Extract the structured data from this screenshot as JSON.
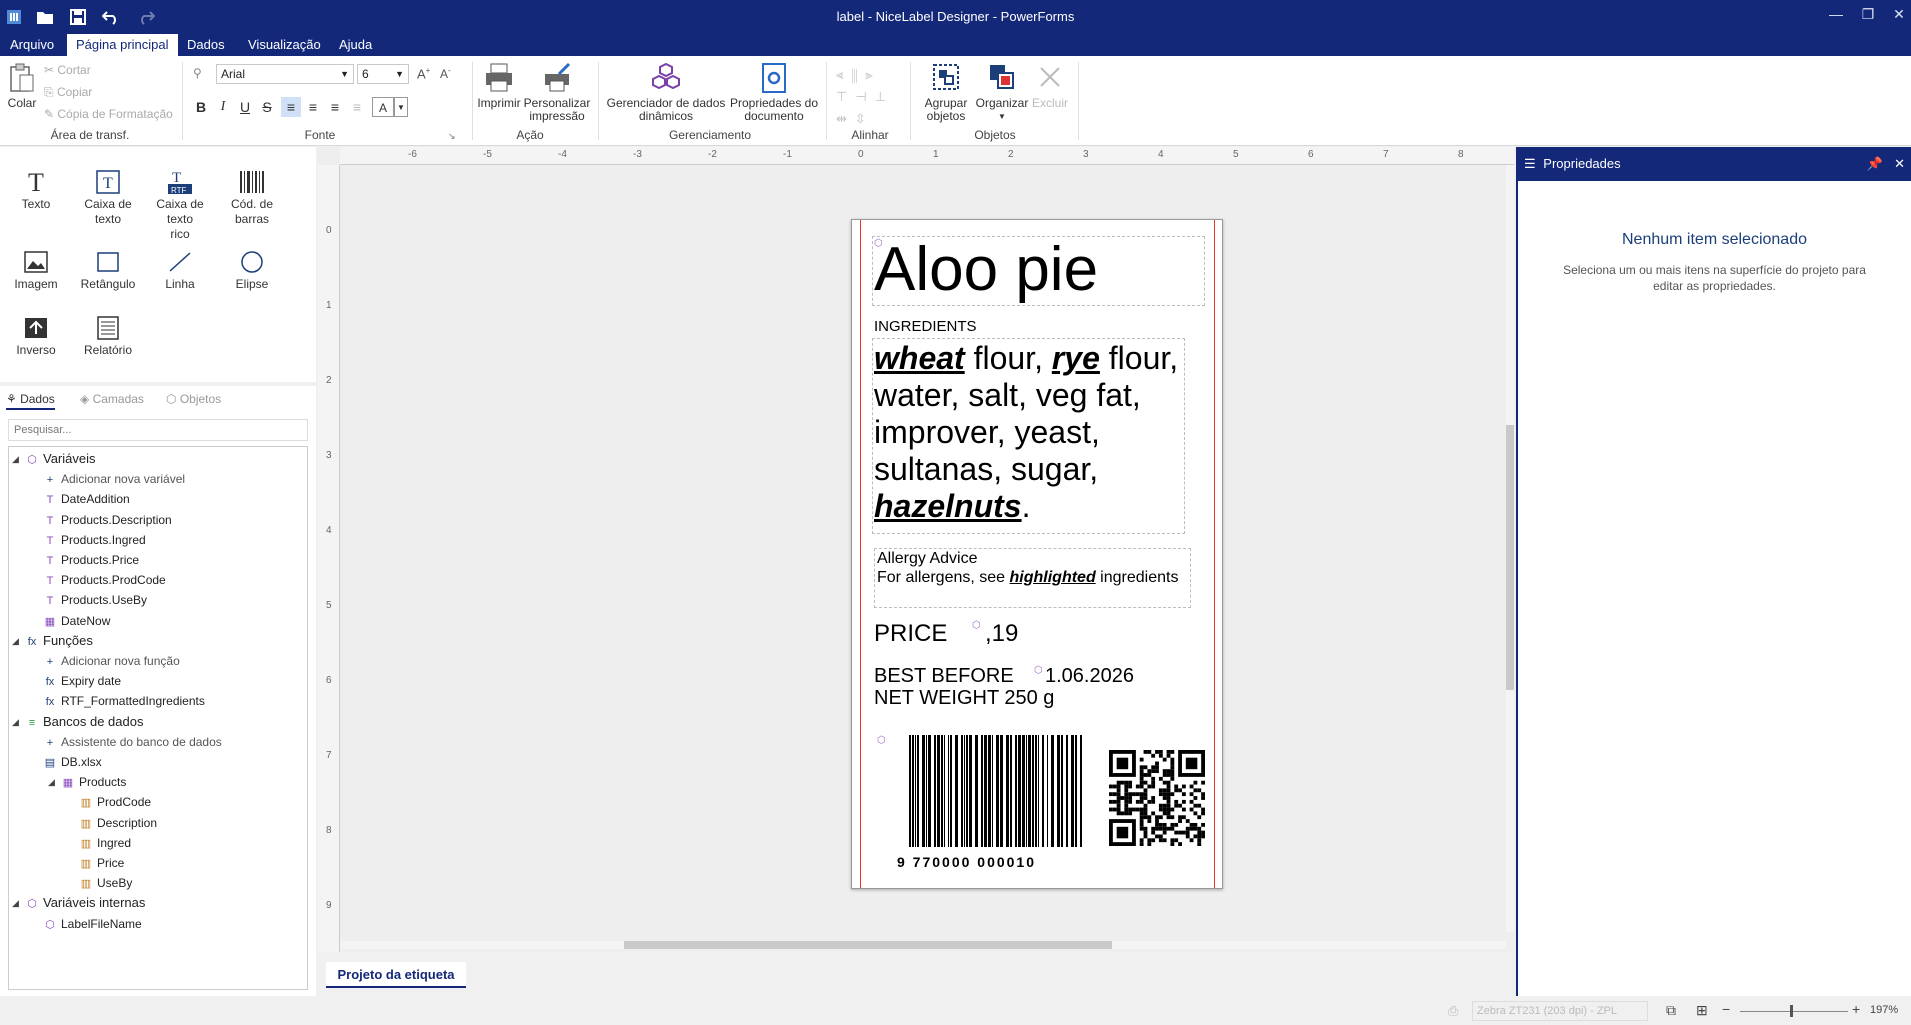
{
  "window": {
    "title": "label - NiceLabel Designer - PowerForms"
  },
  "menu": {
    "items": [
      "Arquivo",
      "Página principal",
      "Dados",
      "Visualização",
      "Ajuda"
    ],
    "active": "Página principal"
  },
  "ribbon": {
    "clipboard": {
      "paste": "Colar",
      "cut": "Cortar",
      "copy": "Copiar",
      "format_copy": "Cópia de Formatação",
      "group": "Área de transf."
    },
    "font": {
      "name": "Arial",
      "size": "6",
      "color_btn": "A",
      "group": "Fonte"
    },
    "action": {
      "print": "Imprimir",
      "customize1": "Personalizar",
      "customize2": "impressão",
      "group": "Ação"
    },
    "manage": {
      "dyn1": "Gerenciador de dados",
      "dyn2": "dinâmicos",
      "props1": "Propriedades do",
      "props2": "documento",
      "group": "Gerenciamento"
    },
    "align": {
      "group": "Alinhar"
    },
    "objects": {
      "group1": "Agrupar",
      "group2": "objetos",
      "arrange": "Organizar",
      "delete": "Excluir",
      "group": "Objetos"
    }
  },
  "toolbox": {
    "text": "Texto",
    "textbox1": "Caixa de",
    "textbox2": "texto",
    "rich1": "Caixa de",
    "rich2": "texto",
    "rich3": "rico",
    "rtf_tag": "RTF",
    "barcode1": "Cód. de",
    "barcode2": "barras",
    "image": "Imagem",
    "rect": "Retângulo",
    "line": "Linha",
    "ellipse": "Elipse",
    "inverse": "Inverso",
    "report": "Relatório"
  },
  "data_panel": {
    "tabs": [
      "Dados",
      "Camadas",
      "Objetos"
    ],
    "search_placeholder": "Pesquisar...",
    "tree": [
      {
        "label": "Variáveis",
        "glyph": "⬡",
        "level": 0
      },
      {
        "label": "Adicionar nova variável",
        "glyph": "+",
        "level": 1
      },
      {
        "label": "DateAddition",
        "glyph": "T",
        "level": 1
      },
      {
        "label": "Products.Description",
        "glyph": "T",
        "level": 1
      },
      {
        "label": "Products.Ingred",
        "glyph": "T",
        "level": 1
      },
      {
        "label": "Products.Price",
        "glyph": "T",
        "level": 1
      },
      {
        "label": "Products.ProdCode",
        "glyph": "T",
        "level": 1
      },
      {
        "label": "Products.UseBy",
        "glyph": "T",
        "level": 1
      },
      {
        "label": "DateNow",
        "glyph": "▦",
        "level": 1
      },
      {
        "label": "Funções",
        "glyph": "fx",
        "level": 0
      },
      {
        "label": "Adicionar nova função",
        "glyph": "+",
        "level": 1
      },
      {
        "label": "Expiry date",
        "glyph": "fx",
        "level": 1
      },
      {
        "label": "RTF_FormattedIngredients",
        "glyph": "fx",
        "level": 1
      },
      {
        "label": "Bancos de dados",
        "glyph": "≡",
        "level": 0
      },
      {
        "label": "Assistente do banco de dados",
        "glyph": "+",
        "level": 1
      },
      {
        "label": "DB.xlsx",
        "glyph": "▤",
        "level": 1
      },
      {
        "label": "Products",
        "glyph": "▦",
        "level": 2
      },
      {
        "label": "ProdCode",
        "glyph": "▥",
        "level": 3
      },
      {
        "label": "Description",
        "glyph": "▥",
        "level": 3
      },
      {
        "label": "Ingred",
        "glyph": "▥",
        "level": 3
      },
      {
        "label": "Price",
        "glyph": "▥",
        "level": 3
      },
      {
        "label": "UseBy",
        "glyph": "▥",
        "level": 3
      },
      {
        "label": "Variáveis internas",
        "glyph": "⬡",
        "level": 0
      },
      {
        "label": "LabelFileName",
        "glyph": "⬡",
        "level": 1
      }
    ]
  },
  "ruler": {
    "h_ticks": [
      "-6",
      "-5",
      "-4",
      "-3",
      "-2",
      "-1",
      "0",
      "1",
      "2",
      "3",
      "4",
      "5",
      "6",
      "7",
      "8"
    ],
    "v_ticks": [
      "0",
      "1",
      "2",
      "3",
      "4",
      "5",
      "6",
      "7",
      "8",
      "9"
    ]
  },
  "label": {
    "title": "Aloo pie",
    "ingredients_header": "INGREDIENTS",
    "ingredients": [
      {
        "text": "wheat",
        "allergen": true
      },
      {
        "text": " flour, ",
        "allergen": false
      },
      {
        "text": "rye",
        "allergen": true
      },
      {
        "text": " flour, water, salt, veg fat, improver, yeast, sultanas, sugar, ",
        "allergen": false
      },
      {
        "text": "hazelnuts",
        "allergen": true
      },
      {
        "text": ".",
        "allergen": false
      }
    ],
    "allergy_title": "Allergy Advice",
    "allergy_pre": "For allergens, see ",
    "allergy_em": "highlighted",
    "allergy_post": " ingredients",
    "price_label": "PRICE",
    "price_value": ",19",
    "best_before_label": "BEST BEFORE",
    "best_before_value": "1.06.2026",
    "net_weight": "NET WEIGHT 250 g",
    "barcode_digits": "9 770000 000010"
  },
  "properties": {
    "title": "Propriedades",
    "empty_title": "Nenhum item selecionado",
    "empty_desc": "Seleciona um ou mais itens na superfície do projeto para editar as propriedades."
  },
  "bottom_tab": "Projeto da etiqueta",
  "status": {
    "printer": "Zebra ZT231 (203 dpi) - ZPL",
    "zoom": "197%"
  },
  "colors": {
    "brand": "#14287a",
    "allergen": "#000000",
    "guide": "#e33333"
  }
}
